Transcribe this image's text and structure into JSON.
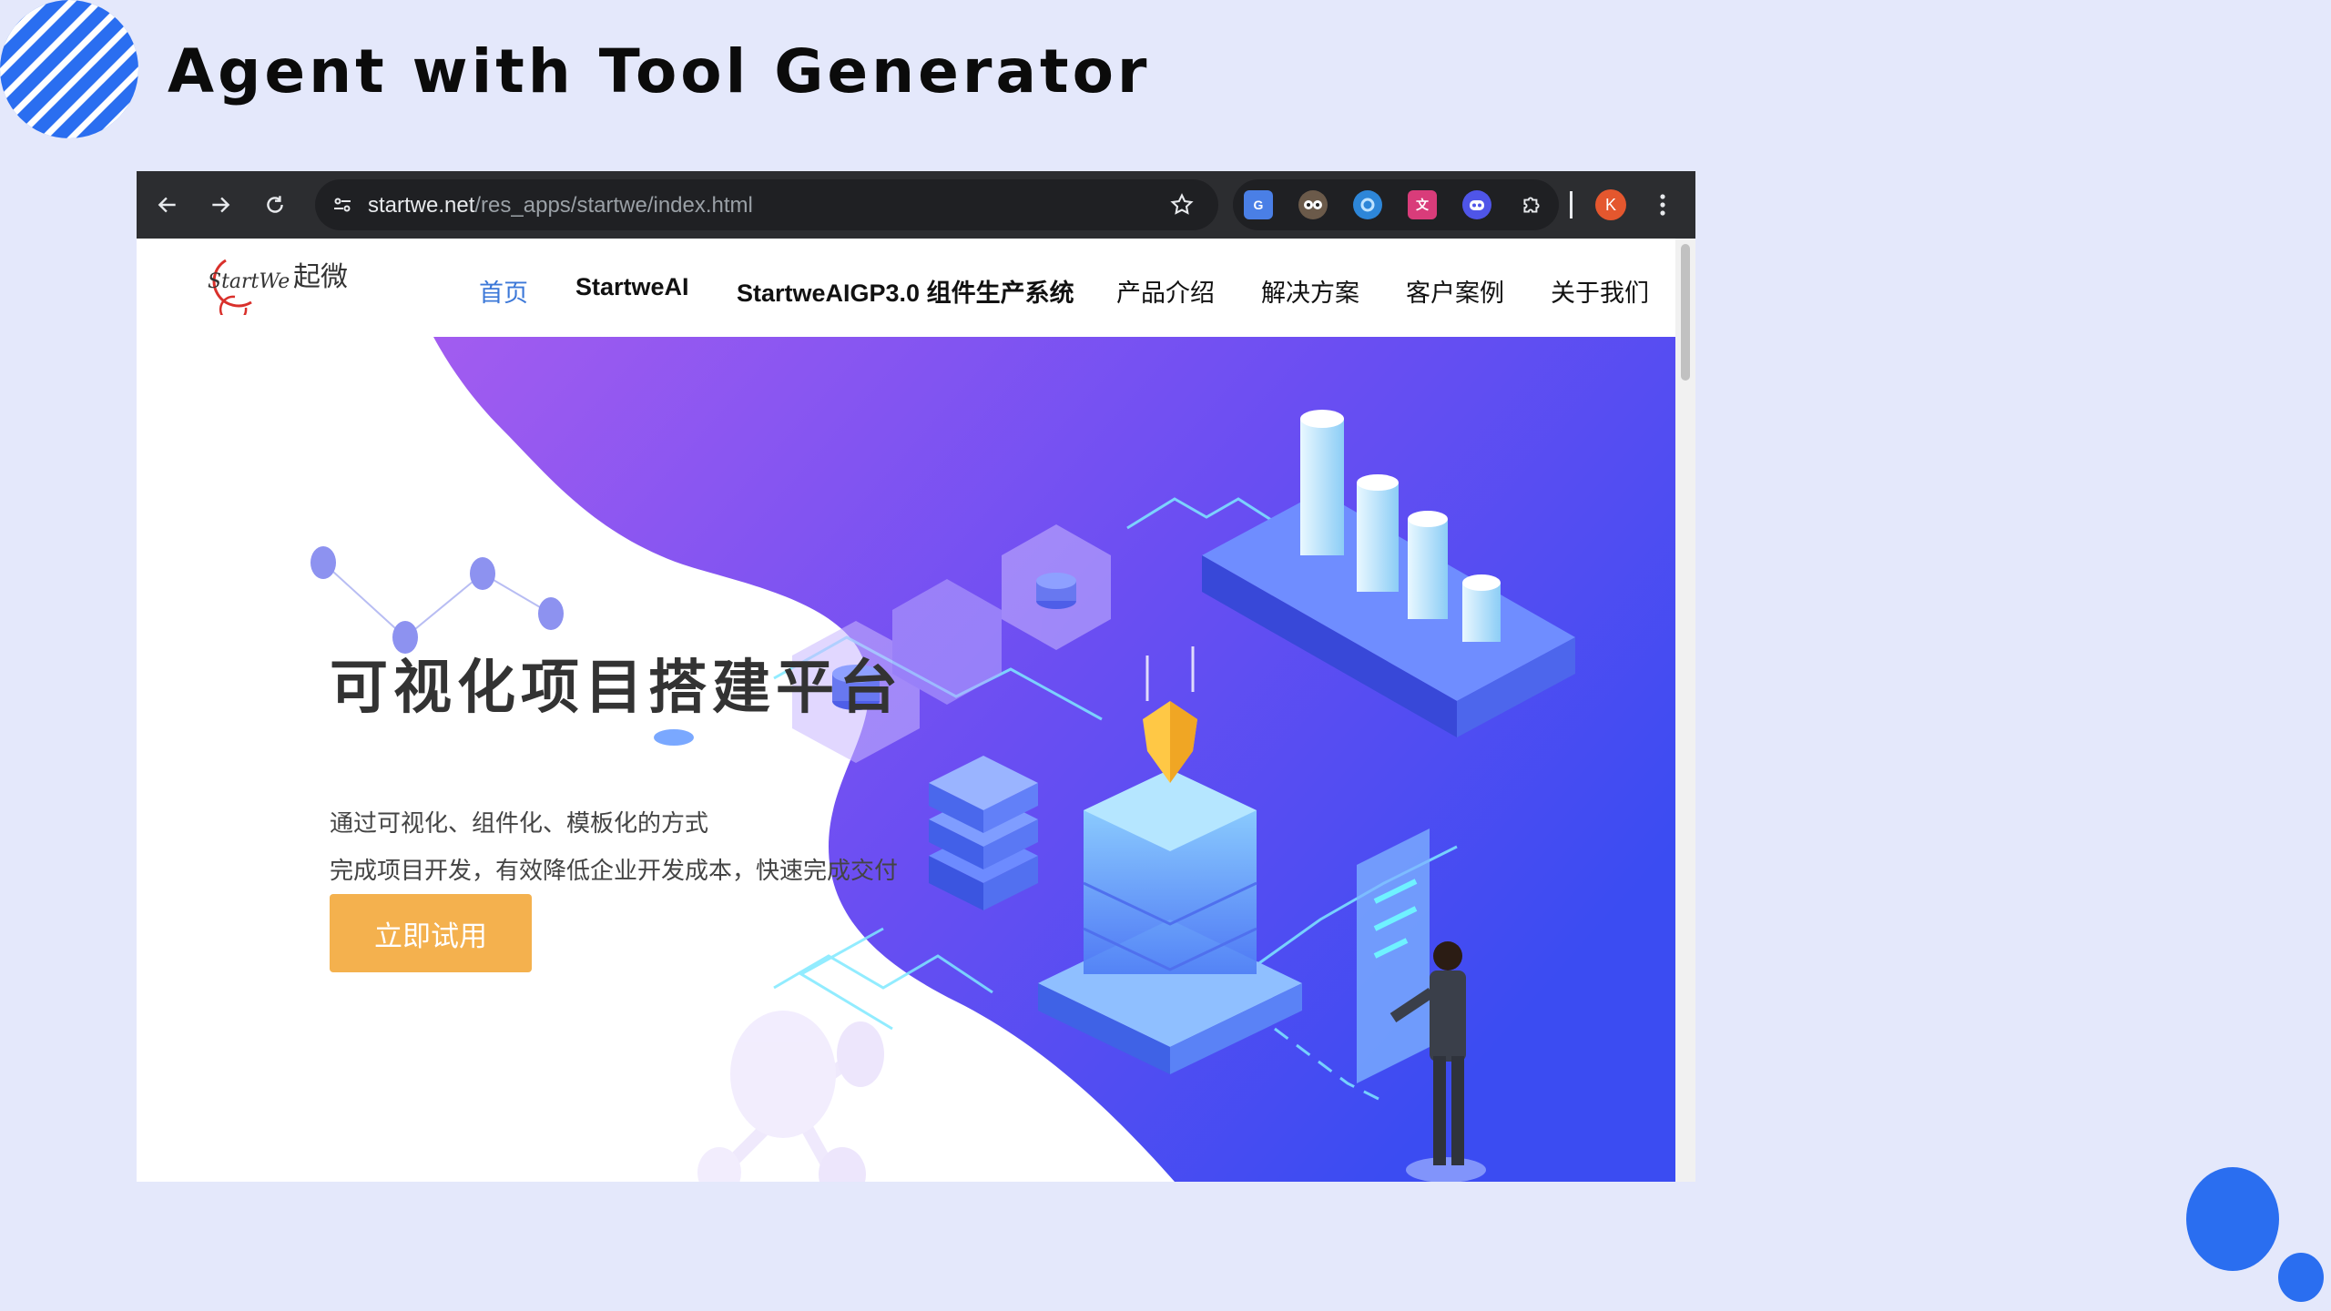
{
  "slide": {
    "title": "Agent with Tool Generator",
    "accent_color": "#2a6ef0",
    "background": "#e4e8fb"
  },
  "browser": {
    "nav_buttons": [
      "back-icon",
      "forward-icon",
      "reload-icon"
    ],
    "url_host": "startwe.net",
    "url_path": "/res_apps/startwe/index.html",
    "extensions": [
      "google-translate-icon",
      "owl-extension-icon",
      "blue-swirl-extension-icon",
      "translate-extension-icon",
      "robot-extension-icon",
      "puzzle-extensions-icon"
    ],
    "profile_initial": "K",
    "profile_color": "#e4572e"
  },
  "site": {
    "logo_text_latin": "StartWe",
    "logo_text_cjk": "起微",
    "nav": {
      "home": "首页",
      "ai": "StartweAI",
      "aigp": "StartweAIGP3.0 组件生产系统",
      "products": "产品介绍",
      "solutions": "解决方案",
      "cases": "客户案例",
      "about": "关于我们"
    },
    "nav_active_color": "#3c78d8",
    "hero": {
      "title": "可视化项目搭建平台",
      "subtitle_line1": "通过可视化、组件化、模板化的方式",
      "subtitle_line2": "完成项目开发，有效降低企业开发成本，快速完成交付",
      "cta_label": "立即试用",
      "cta_color": "#f4b14e",
      "gradient_from": "#a25cf0",
      "gradient_to": "#3b4cf2"
    }
  }
}
